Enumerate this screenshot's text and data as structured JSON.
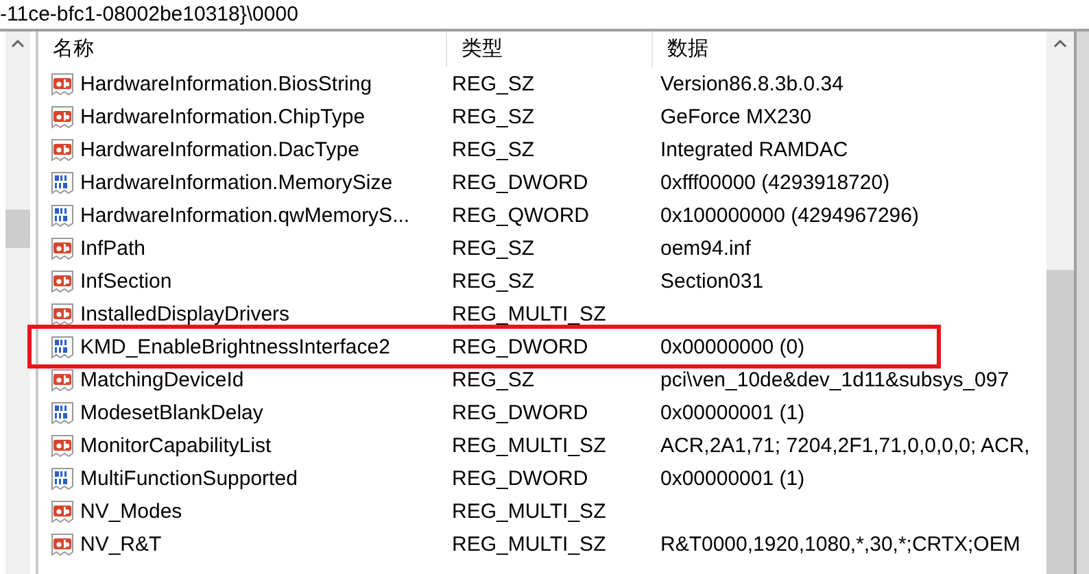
{
  "address_bar": {
    "path": "-11ce-bfc1-08002be10318}\\0000"
  },
  "columns": [
    "名称",
    "类型",
    "数据"
  ],
  "rows": [
    {
      "kind": "string",
      "name": "HardwareInformation.BiosString",
      "type": "REG_SZ",
      "data": "Version86.8.3b.0.34",
      "outlined": false
    },
    {
      "kind": "string",
      "name": "HardwareInformation.ChipType",
      "type": "REG_SZ",
      "data": "GeForce MX230",
      "outlined": false
    },
    {
      "kind": "string",
      "name": "HardwareInformation.DacType",
      "type": "REG_SZ",
      "data": "Integrated RAMDAC",
      "outlined": false
    },
    {
      "kind": "binary",
      "name": "HardwareInformation.MemorySize",
      "type": "REG_DWORD",
      "data": "0xfff00000 (4293918720)",
      "outlined": false
    },
    {
      "kind": "binary",
      "name": "HardwareInformation.qwMemoryS...",
      "type": "REG_QWORD",
      "data": "0x100000000 (4294967296)",
      "outlined": false
    },
    {
      "kind": "string",
      "name": "InfPath",
      "type": "REG_SZ",
      "data": "oem94.inf",
      "outlined": false
    },
    {
      "kind": "string",
      "name": "InfSection",
      "type": "REG_SZ",
      "data": "Section031",
      "outlined": false
    },
    {
      "kind": "string",
      "name": "InstalledDisplayDrivers",
      "type": "REG_MULTI_SZ",
      "data": "",
      "outlined": false
    },
    {
      "kind": "binary",
      "name": "KMD_EnableBrightnessInterface2",
      "type": "REG_DWORD",
      "data": "0x00000000 (0)",
      "outlined": true
    },
    {
      "kind": "string",
      "name": "MatchingDeviceId",
      "type": "REG_SZ",
      "data": "pci\\ven_10de&dev_1d11&subsys_097",
      "outlined": false
    },
    {
      "kind": "binary",
      "name": "ModesetBlankDelay",
      "type": "REG_DWORD",
      "data": "0x00000001 (1)",
      "outlined": false
    },
    {
      "kind": "string",
      "name": "MonitorCapabilityList",
      "type": "REG_MULTI_SZ",
      "data": "ACR,2A1,71; 7204,2F1,71,0,0,0,0; ACR,",
      "outlined": false
    },
    {
      "kind": "binary",
      "name": "MultiFunctionSupported",
      "type": "REG_DWORD",
      "data": "0x00000001 (1)",
      "outlined": false
    },
    {
      "kind": "string",
      "name": "NV_Modes",
      "type": "REG_MULTI_SZ",
      "data": "",
      "outlined": false
    },
    {
      "kind": "string",
      "name": "NV_R&T",
      "type": "REG_MULTI_SZ",
      "data": "R&T0000,1920,1080,*,30,*;CRTX;OEM",
      "outlined": false
    }
  ]
}
